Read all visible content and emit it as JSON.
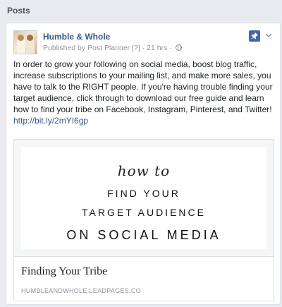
{
  "section": {
    "title": "Posts"
  },
  "post": {
    "page_name": "Humble & Whole",
    "meta_prefix": "Published by Post Planner ",
    "meta_bracket": "[?]",
    "meta_separator": " · ",
    "meta_time": "21 hrs",
    "meta_dot": " · ",
    "body_text": "In order to grow your following on social media, boost blog traffic, increase subscriptions to your mailing list, and make more sales, you have to talk to the RIGHT people. If you're having trouble finding your target audience, click through to download our free guide and learn how to find your tribe on Facebook, Instagram, Pinterest, and Twitter!",
    "link": "http://bit.ly/2mYI6gp",
    "icons": {
      "pin": "pin-icon",
      "chevron": "chevron-down-icon",
      "globe": "globe-icon"
    },
    "pin_color": "#4267b2"
  },
  "attachment": {
    "image_lines": {
      "script": "how to",
      "line1": "FIND YOUR",
      "line2": "TARGET AUDIENCE",
      "line3": "ON SOCIAL MEDIA"
    },
    "title": "Finding Your Tribe",
    "domain": "HUMBLEANDWHOLE.LEADPAGES.CO"
  }
}
